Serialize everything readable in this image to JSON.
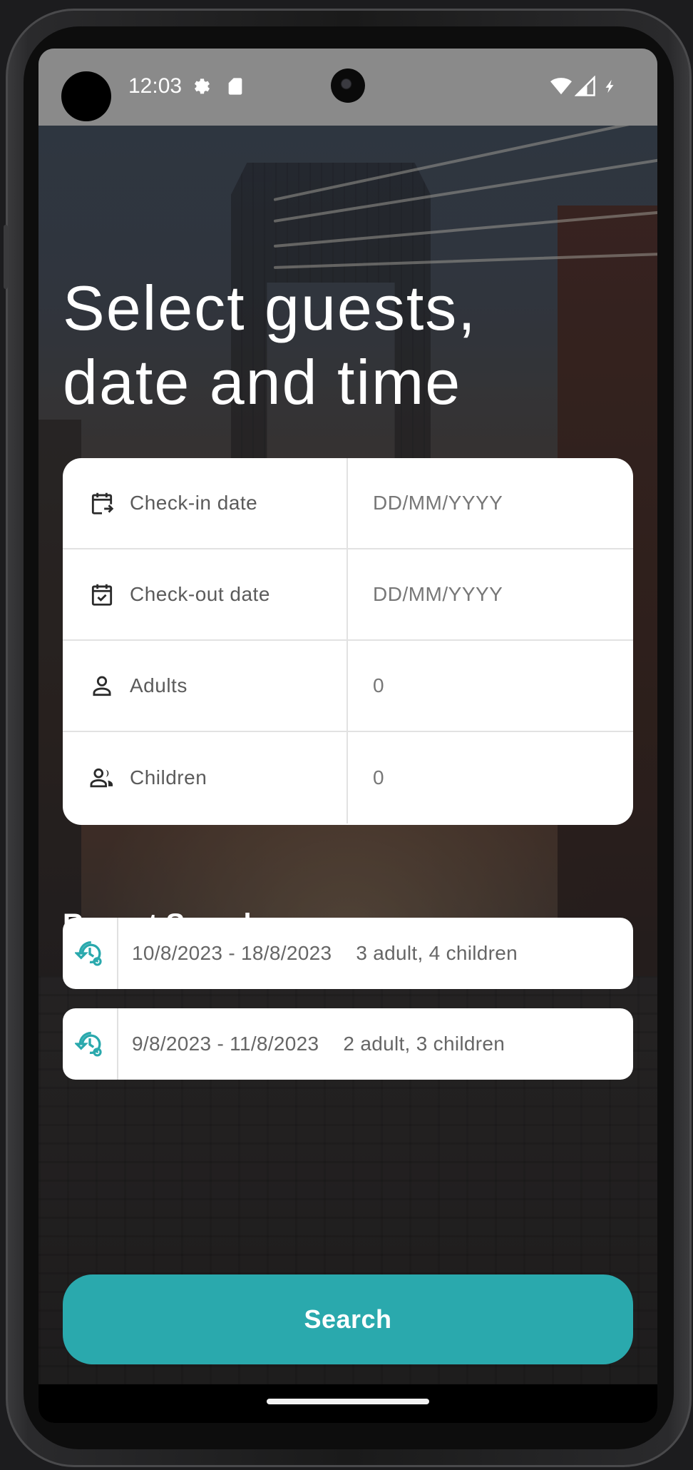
{
  "status_bar": {
    "time": "12:03",
    "icons": [
      "settings-icon",
      "sd-card-icon",
      "wifi-icon",
      "signal-icon",
      "battery-icon"
    ]
  },
  "title": {
    "line1": "Select guests,",
    "line2": "date and time"
  },
  "form": {
    "rows": [
      {
        "icon": "calendar-checkin-icon",
        "label": "Check-in date",
        "value": "DD/MM/YYYY"
      },
      {
        "icon": "calendar-checkout-icon",
        "label": "Check-out date",
        "value": "DD/MM/YYYY"
      },
      {
        "icon": "person-icon",
        "label": "Adults",
        "value": "0"
      },
      {
        "icon": "people-icon",
        "label": "Children",
        "value": "0"
      }
    ]
  },
  "recent": {
    "heading": "Recent Searches",
    "items": [
      {
        "icon": "history-settings-icon",
        "dates": "10/8/2023 - 18/8/2023",
        "guests": "3 adult, 4 children"
      },
      {
        "icon": "history-settings-icon",
        "dates": "9/8/2023 - 11/8/2023",
        "guests": "2 adult, 3 children"
      }
    ]
  },
  "search_button": {
    "label": "Search"
  },
  "colors": {
    "accent": "#2aa9ad",
    "card": "#ffffff",
    "label_text": "#5b5b5b",
    "value_text": "#777777"
  }
}
